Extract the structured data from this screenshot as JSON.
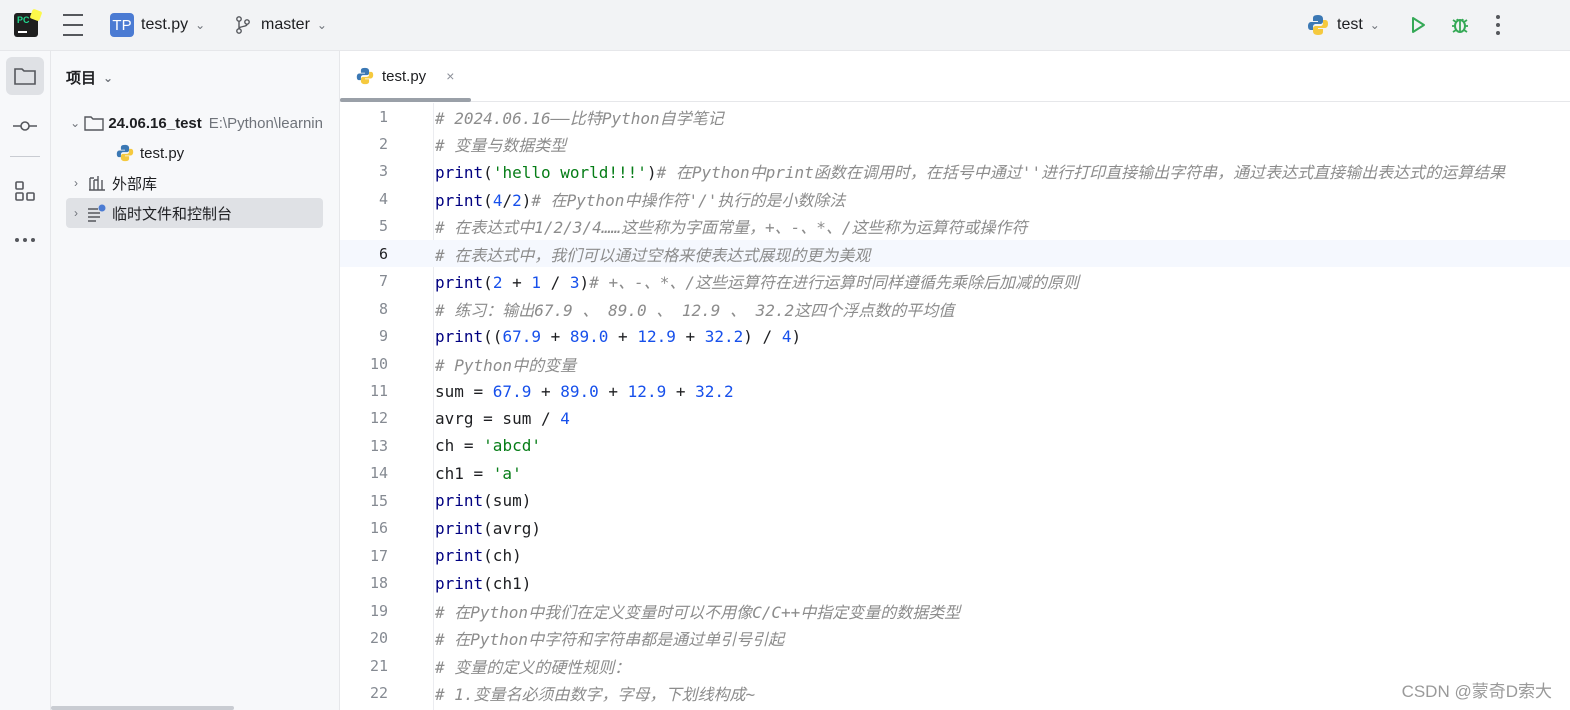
{
  "topbar": {
    "project_badge": "TP",
    "project_name": "test.py",
    "branch": "master",
    "run_config": "test"
  },
  "panel": {
    "title": "项目",
    "tree": [
      {
        "label": "24.06.16_test",
        "path": "E:\\Python\\learnin",
        "expanded": true
      },
      {
        "label": "test.py"
      },
      {
        "label": "外部库",
        "expanded": false
      },
      {
        "label": "临时文件和控制台",
        "expanded": false,
        "selected": true
      }
    ]
  },
  "tab": {
    "label": "test.py",
    "close": "×"
  },
  "editor": {
    "current_line": 6,
    "lines": [
      {
        "n": "1",
        "tokens": [
          [
            "cm",
            "# 2024.06.16——比特Python自学笔记"
          ]
        ]
      },
      {
        "n": "2",
        "tokens": [
          [
            "cm",
            "# 变量与数据类型"
          ]
        ]
      },
      {
        "n": "3",
        "tokens": [
          [
            "kw",
            "print"
          ],
          [
            "id",
            "("
          ],
          [
            "str",
            "'hello world!!!'"
          ],
          [
            "id",
            ")"
          ],
          [
            "cm",
            "# 在Python中print函数在调用时，在括号中通过''进行打印直接输出字符串，通过表达式直接输出表达式的运算结果"
          ]
        ]
      },
      {
        "n": "4",
        "tokens": [
          [
            "kw",
            "print"
          ],
          [
            "id",
            "("
          ],
          [
            "num",
            "4"
          ],
          [
            "id",
            "/"
          ],
          [
            "num",
            "2"
          ],
          [
            "id",
            ")"
          ],
          [
            "cm",
            "# 在Python中操作符'/'执行的是小数除法"
          ]
        ]
      },
      {
        "n": "5",
        "tokens": [
          [
            "cm",
            "# 在表达式中1/2/3/4……这些称为字面常量，+、-、*、/这些称为运算符或操作符"
          ]
        ]
      },
      {
        "n": "6",
        "tokens": [
          [
            "cm",
            "# 在表达式中，我们可以通过空格来使表达式展现的更为美观"
          ]
        ]
      },
      {
        "n": "7",
        "tokens": [
          [
            "kw",
            "print"
          ],
          [
            "id",
            "("
          ],
          [
            "num",
            "2"
          ],
          [
            "id",
            " + "
          ],
          [
            "num",
            "1"
          ],
          [
            "id",
            " / "
          ],
          [
            "num",
            "3"
          ],
          [
            "id",
            ")"
          ],
          [
            "cm",
            "# +、-、*、/这些运算符在进行运算时同样遵循先乘除后加减的原则"
          ]
        ]
      },
      {
        "n": "8",
        "tokens": [
          [
            "cm",
            "# 练习：输出67.9 、 89.0 、 12.9 、 32.2这四个浮点数的平均值"
          ]
        ]
      },
      {
        "n": "9",
        "tokens": [
          [
            "kw",
            "print"
          ],
          [
            "id",
            "(("
          ],
          [
            "num",
            "67.9"
          ],
          [
            "id",
            " + "
          ],
          [
            "num",
            "89.0"
          ],
          [
            "id",
            " + "
          ],
          [
            "num",
            "12.9"
          ],
          [
            "id",
            " + "
          ],
          [
            "num",
            "32.2"
          ],
          [
            "id",
            ") / "
          ],
          [
            "num",
            "4"
          ],
          [
            "id",
            ")"
          ]
        ]
      },
      {
        "n": "10",
        "tokens": [
          [
            "cm",
            "# Python中的变量"
          ]
        ]
      },
      {
        "n": "11",
        "tokens": [
          [
            "id",
            "sum = "
          ],
          [
            "num",
            "67.9"
          ],
          [
            "id",
            " + "
          ],
          [
            "num",
            "89.0"
          ],
          [
            "id",
            " + "
          ],
          [
            "num",
            "12.9"
          ],
          [
            "id",
            " + "
          ],
          [
            "num",
            "32.2"
          ]
        ]
      },
      {
        "n": "12",
        "tokens": [
          [
            "id",
            "avrg = sum / "
          ],
          [
            "num",
            "4"
          ]
        ]
      },
      {
        "n": "13",
        "tokens": [
          [
            "id",
            "ch = "
          ],
          [
            "str",
            "'abcd'"
          ]
        ]
      },
      {
        "n": "14",
        "tokens": [
          [
            "id",
            "ch1 = "
          ],
          [
            "str",
            "'a'"
          ]
        ]
      },
      {
        "n": "15",
        "tokens": [
          [
            "kw",
            "print"
          ],
          [
            "id",
            "(sum)"
          ]
        ]
      },
      {
        "n": "16",
        "tokens": [
          [
            "kw",
            "print"
          ],
          [
            "id",
            "(avrg)"
          ]
        ]
      },
      {
        "n": "17",
        "tokens": [
          [
            "kw",
            "print"
          ],
          [
            "id",
            "(ch)"
          ]
        ]
      },
      {
        "n": "18",
        "tokens": [
          [
            "kw",
            "print"
          ],
          [
            "id",
            "(ch1)"
          ]
        ]
      },
      {
        "n": "19",
        "tokens": [
          [
            "cm",
            "# 在Python中我们在定义变量时可以不用像C/C++中指定变量的数据类型"
          ]
        ]
      },
      {
        "n": "20",
        "tokens": [
          [
            "cm",
            "# 在Python中字符和字符串都是通过单引号引起"
          ]
        ]
      },
      {
        "n": "21",
        "tokens": [
          [
            "cm",
            "# 变量的定义的硬性规则："
          ]
        ]
      },
      {
        "n": "22",
        "tokens": [
          [
            "cm",
            "# 1.变量名必须由数字，字母，下划线构成~"
          ]
        ]
      }
    ]
  },
  "watermark": "CSDN @蒙奇D索大",
  "colors": {
    "comment": "#8c8c8c",
    "keyword": "#000080",
    "string": "#067d17",
    "number": "#1750eb",
    "run": "#36a957",
    "debug": "#36a957"
  }
}
